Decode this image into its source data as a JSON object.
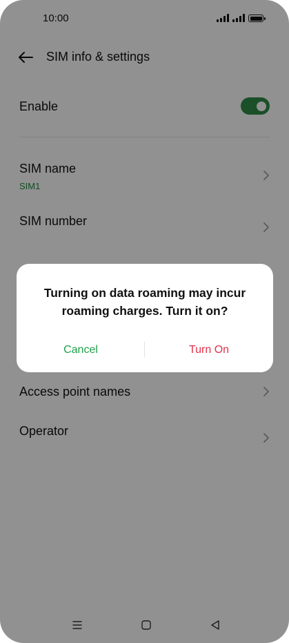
{
  "status_bar": {
    "time": "10:00"
  },
  "header": {
    "title": "SIM info & settings",
    "back_icon": "arrow-left-icon"
  },
  "settings": {
    "enable_label": "Enable",
    "enable_on": true,
    "sim_name_label": "SIM name",
    "sim_name_value": "SIM1",
    "sim_number_label": "SIM number",
    "access_point_label": "Access point names",
    "operator_label": "Operator"
  },
  "dialog": {
    "message": "Turning on data roaming may incur roaming charges. Turn it on?",
    "cancel_label": "Cancel",
    "confirm_label": "Turn On"
  },
  "nav_bar": {
    "icons": [
      "menu-icon",
      "home-icon",
      "back-icon"
    ]
  },
  "colors": {
    "accent_green": "#2e8b47",
    "cancel_green": "#1fa04a",
    "confirm_red": "#e03148",
    "scrim": "rgba(0,0,0,0.43)"
  }
}
